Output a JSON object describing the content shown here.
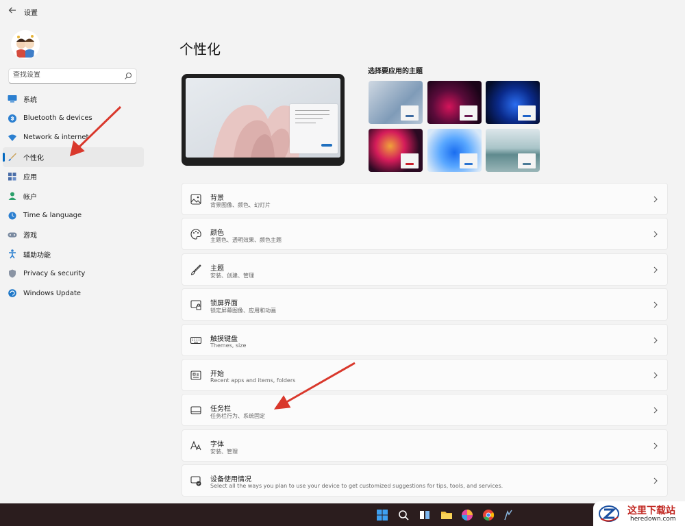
{
  "window": {
    "title": "设置"
  },
  "search": {
    "placeholder": "查找设置"
  },
  "sidebar": {
    "items": [
      {
        "label": "系统",
        "icon": "monitor-icon"
      },
      {
        "label": "Bluetooth & devices",
        "icon": "bluetooth-icon"
      },
      {
        "label": "Network & internet",
        "icon": "wifi-icon"
      },
      {
        "label": "个性化",
        "icon": "brush-icon",
        "active": true
      },
      {
        "label": "应用",
        "icon": "apps-icon"
      },
      {
        "label": "帐户",
        "icon": "person-icon"
      },
      {
        "label": "Time & language",
        "icon": "globe-clock-icon"
      },
      {
        "label": "游戏",
        "icon": "gamepad-icon"
      },
      {
        "label": "辅助功能",
        "icon": "accessibility-icon"
      },
      {
        "label": "Privacy & security",
        "icon": "shield-icon"
      },
      {
        "label": "Windows Update",
        "icon": "update-icon"
      }
    ]
  },
  "main": {
    "page_title": "个性化",
    "themes_title": "选择要应用的主题",
    "cards": [
      {
        "title": "背景",
        "subtitle": "背景图像、颜色、幻灯片",
        "icon": "image-icon"
      },
      {
        "title": "颜色",
        "subtitle": "主题色、透明效果、颜色主题",
        "icon": "palette-icon"
      },
      {
        "title": "主题",
        "subtitle": "安装、创建、管理",
        "icon": "brush-icon"
      },
      {
        "title": "锁屏界面",
        "subtitle": "锁定屏幕图像、应用和动画",
        "icon": "lock-screen-icon"
      },
      {
        "title": "触摸键盘",
        "subtitle": "Themes, size",
        "icon": "keyboard-icon"
      },
      {
        "title": "开始",
        "subtitle": "Recent apps and items, folders",
        "icon": "start-icon"
      },
      {
        "title": "任务栏",
        "subtitle": "任务栏行为、系统固定",
        "icon": "taskbar-icon"
      },
      {
        "title": "字体",
        "subtitle": "安装、管理",
        "icon": "font-icon"
      },
      {
        "title": "设备使用情况",
        "subtitle": "Select all the ways you plan to use your device to get customized suggestions for tips, tools, and services.",
        "icon": "device-usage-icon"
      }
    ]
  },
  "watermark": {
    "title": "这里下载站",
    "subtitle": "heredown.com"
  },
  "colors": {
    "accent": "#0067c0",
    "annotation_arrow": "#d9382c"
  }
}
